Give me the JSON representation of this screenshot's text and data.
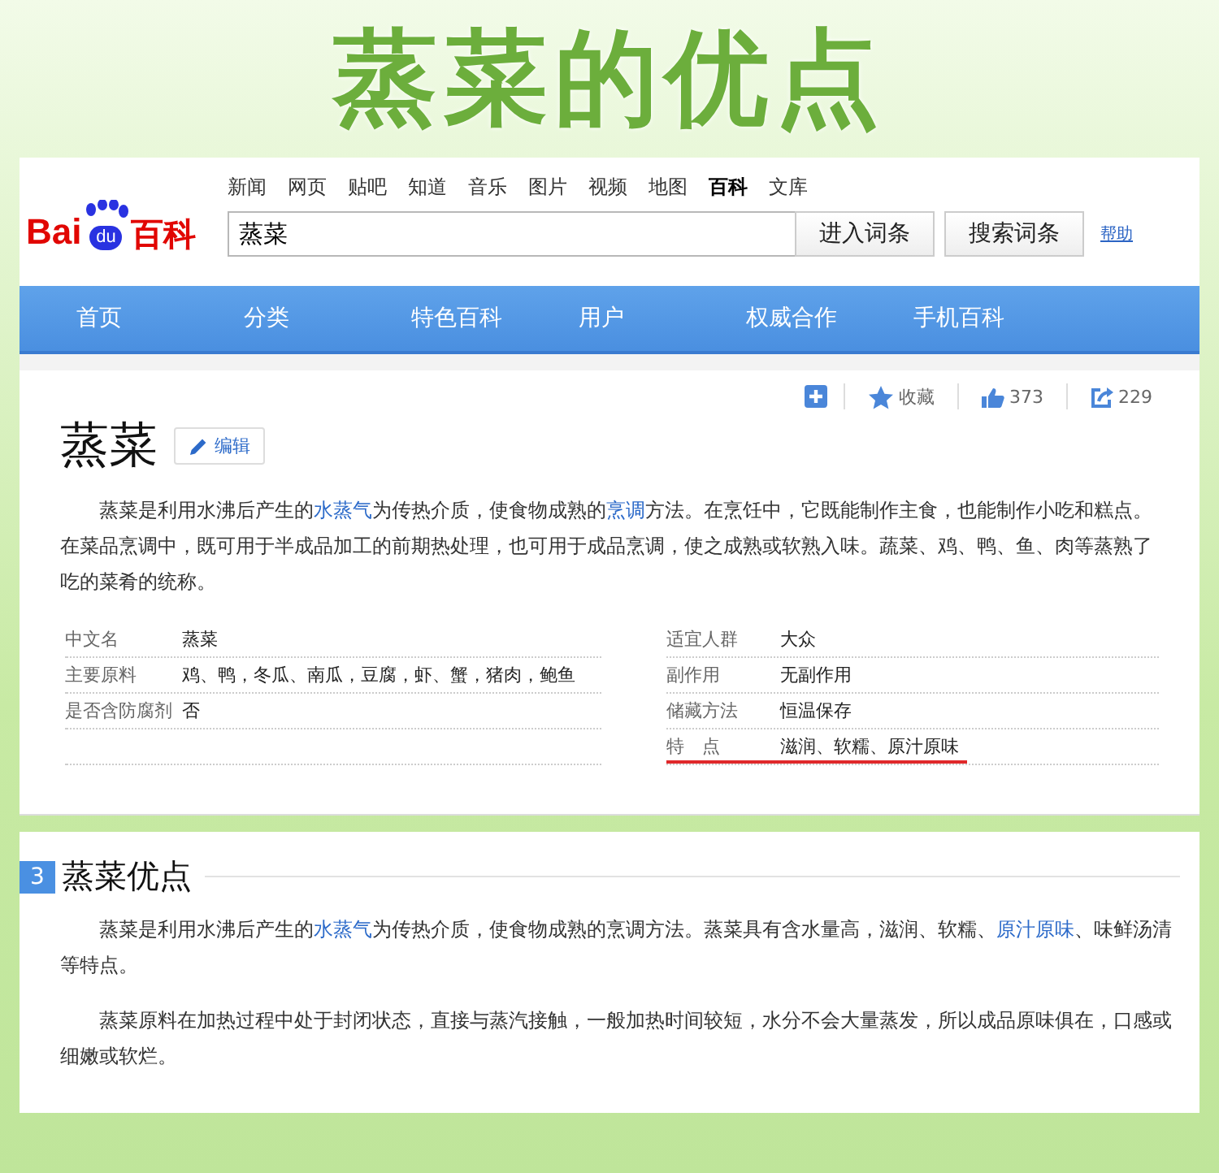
{
  "banner": {
    "title": "蒸菜的优点"
  },
  "header": {
    "logo_text": "Bai",
    "logo_paw": "du",
    "logo_suffix": "百科",
    "top_links": [
      {
        "label": "新闻",
        "selected": false
      },
      {
        "label": "网页",
        "selected": false
      },
      {
        "label": "贴吧",
        "selected": false
      },
      {
        "label": "知道",
        "selected": false
      },
      {
        "label": "音乐",
        "selected": false
      },
      {
        "label": "图片",
        "selected": false
      },
      {
        "label": "视频",
        "selected": false
      },
      {
        "label": "地图",
        "selected": false
      },
      {
        "label": "百科",
        "selected": true
      },
      {
        "label": "文库",
        "selected": false
      }
    ],
    "search": {
      "value": "蒸菜"
    },
    "buttons": [
      "进入词条",
      "搜索词条"
    ],
    "help_link": "帮助"
  },
  "nav": [
    "首页",
    "分类",
    "特色百科",
    "用户",
    "权威合作",
    "手机百科"
  ],
  "actions": {
    "collect": "收藏",
    "likes": "373",
    "shares": "229"
  },
  "entry": {
    "title": "蒸菜",
    "edit": "编辑",
    "summary": [
      {
        "text": "蒸菜是利用水沸后产生的",
        "link": false
      },
      {
        "text": "水蒸气",
        "link": true
      },
      {
        "text": "为传热介质，使食物成熟的",
        "link": false
      },
      {
        "text": "烹调",
        "link": true
      },
      {
        "text": "方法。在烹饪中，它既能制作主食，也能制作小吃和糕点。在菜品烹调中，既可用于半成品加工的前期热处理，也可用于成品烹调，使之成熟或软熟入味。蔬菜、鸡、鸭、鱼、肉等蒸熟了吃的菜肴的统称。",
        "link": false
      }
    ],
    "info_left": [
      {
        "label": "中文名",
        "value": "蒸菜"
      },
      {
        "label": "主要原料",
        "value": "鸡、鸭，冬瓜、南瓜，豆腐，虾、蟹，猪肉，鲍鱼"
      },
      {
        "label": "是否含防腐剂",
        "value": "否"
      }
    ],
    "info_right": [
      {
        "label": "适宜人群",
        "value": "大众",
        "underlined": false
      },
      {
        "label": "副作用",
        "value": "无副作用",
        "underlined": false
      },
      {
        "label": "储藏方法",
        "value": "恒温保存",
        "underlined": false
      },
      {
        "label": "特　点",
        "value": "滋润、软糯、原汁原味",
        "underlined": true
      }
    ]
  },
  "section": {
    "number": "3",
    "title": "蒸菜优点",
    "paragraphs": [
      [
        {
          "text": "蒸菜是利用水沸后产生的",
          "link": false
        },
        {
          "text": "水蒸气",
          "link": true
        },
        {
          "text": "为传热介质，使食物成熟的烹调方法。蒸菜具有含水量高，滋润、软糯、",
          "link": false
        },
        {
          "text": "原汁原味",
          "link": true
        },
        {
          "text": "、味鲜汤清等特点。",
          "link": false
        }
      ],
      [
        {
          "text": "蒸菜原料在加热过程中处于封闭状态，直接与蒸汽接触，一般加热时间较短，水分不会大量蒸发，所以成品原味俱在，口感或细嫩或软烂。",
          "link": false
        }
      ]
    ]
  }
}
